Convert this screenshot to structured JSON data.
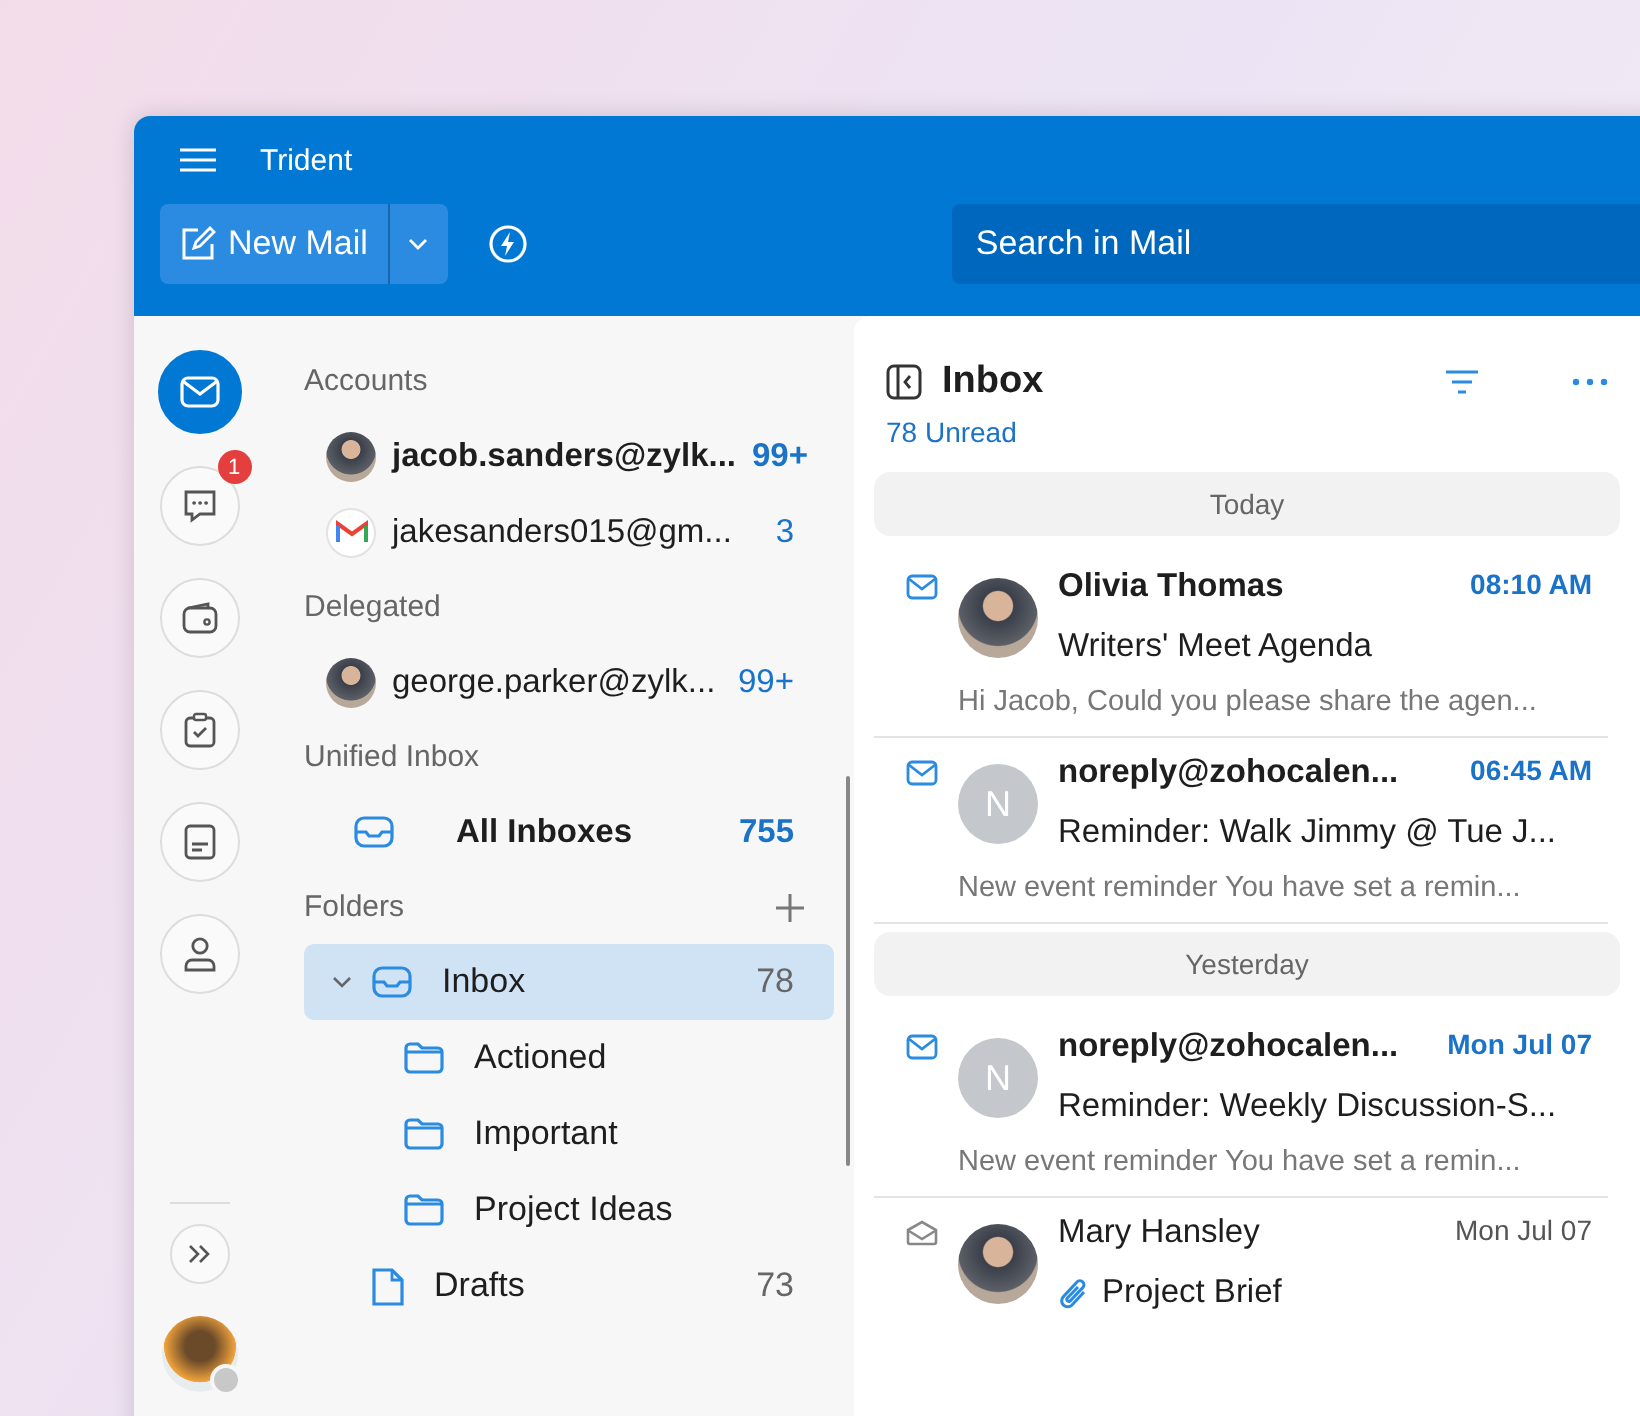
{
  "window": {
    "title": "Trident"
  },
  "toolbar": {
    "new_mail": "New Mail",
    "search": {
      "placeholder": "Search in Mail"
    }
  },
  "rail": [
    {
      "kind": "mail",
      "selected": true
    },
    {
      "kind": "chat",
      "selected": false,
      "badge": "1"
    },
    {
      "kind": "wallet",
      "selected": false
    },
    {
      "kind": "tasks",
      "selected": false
    },
    {
      "kind": "notes",
      "selected": false
    },
    {
      "kind": "contacts",
      "selected": false
    }
  ],
  "sections": [
    {
      "title": "Accounts",
      "items": [
        {
          "kind": "photo",
          "label": "jacob.sanders@zylk...",
          "count": "99+",
          "current": true
        },
        {
          "kind": "gmail",
          "label": "jakesanders015@gm...",
          "count": "3",
          "current": false
        }
      ]
    },
    {
      "title": "Delegated",
      "items": [
        {
          "kind": "photo",
          "label": "george.parker@zylk...",
          "count": "99+",
          "current": false
        }
      ]
    },
    {
      "title": "Unified Inbox",
      "items": [
        {
          "kind": "inbox",
          "label": "All Inboxes",
          "count": "755",
          "current": true
        }
      ]
    }
  ],
  "folders": {
    "title": "Folders",
    "items": [
      {
        "kind": "inbox",
        "label": "Inbox",
        "count": "78",
        "selected": true,
        "expanded": true,
        "children": [
          {
            "kind": "folder",
            "label": "Actioned",
            "selected": false
          },
          {
            "kind": "folder",
            "label": "Important",
            "selected": false
          },
          {
            "kind": "folder",
            "label": "Project Ideas",
            "selected": false
          }
        ]
      },
      {
        "kind": "drafts",
        "label": "Drafts",
        "count": "73",
        "selected": false
      }
    ]
  },
  "mail_list": {
    "title": "Inbox",
    "unread": "78 Unread",
    "groups": [
      {
        "label": "Today",
        "messages": [
          {
            "sender": "Olivia Thomas",
            "kind": "photo",
            "time": "08:10 AM",
            "subject": "Writers' Meet Agenda",
            "preview": "Hi Jacob, Could you please share the agen...",
            "unread": true,
            "attachment": false
          },
          {
            "sender": "noreply@zohocalen...",
            "kind": "initial",
            "initial": "N",
            "time": "06:45 AM",
            "subject": "Reminder: Walk Jimmy @ Tue J...",
            "preview": "New event reminder You have set a remin...",
            "unread": true,
            "attachment": false
          }
        ]
      },
      {
        "label": "Yesterday",
        "messages": [
          {
            "sender": "noreply@zohocalen...",
            "kind": "initial",
            "initial": "N",
            "time": "Mon Jul 07",
            "subject": "Reminder: Weekly Discussion-S...",
            "preview": "New event reminder You have set a remin...",
            "unread": true,
            "attachment": false
          },
          {
            "sender": "Mary Hansley",
            "kind": "photo",
            "time": "Mon Jul 07",
            "subject": "Project Brief",
            "unread": false,
            "attachment": true
          }
        ]
      }
    ]
  }
}
